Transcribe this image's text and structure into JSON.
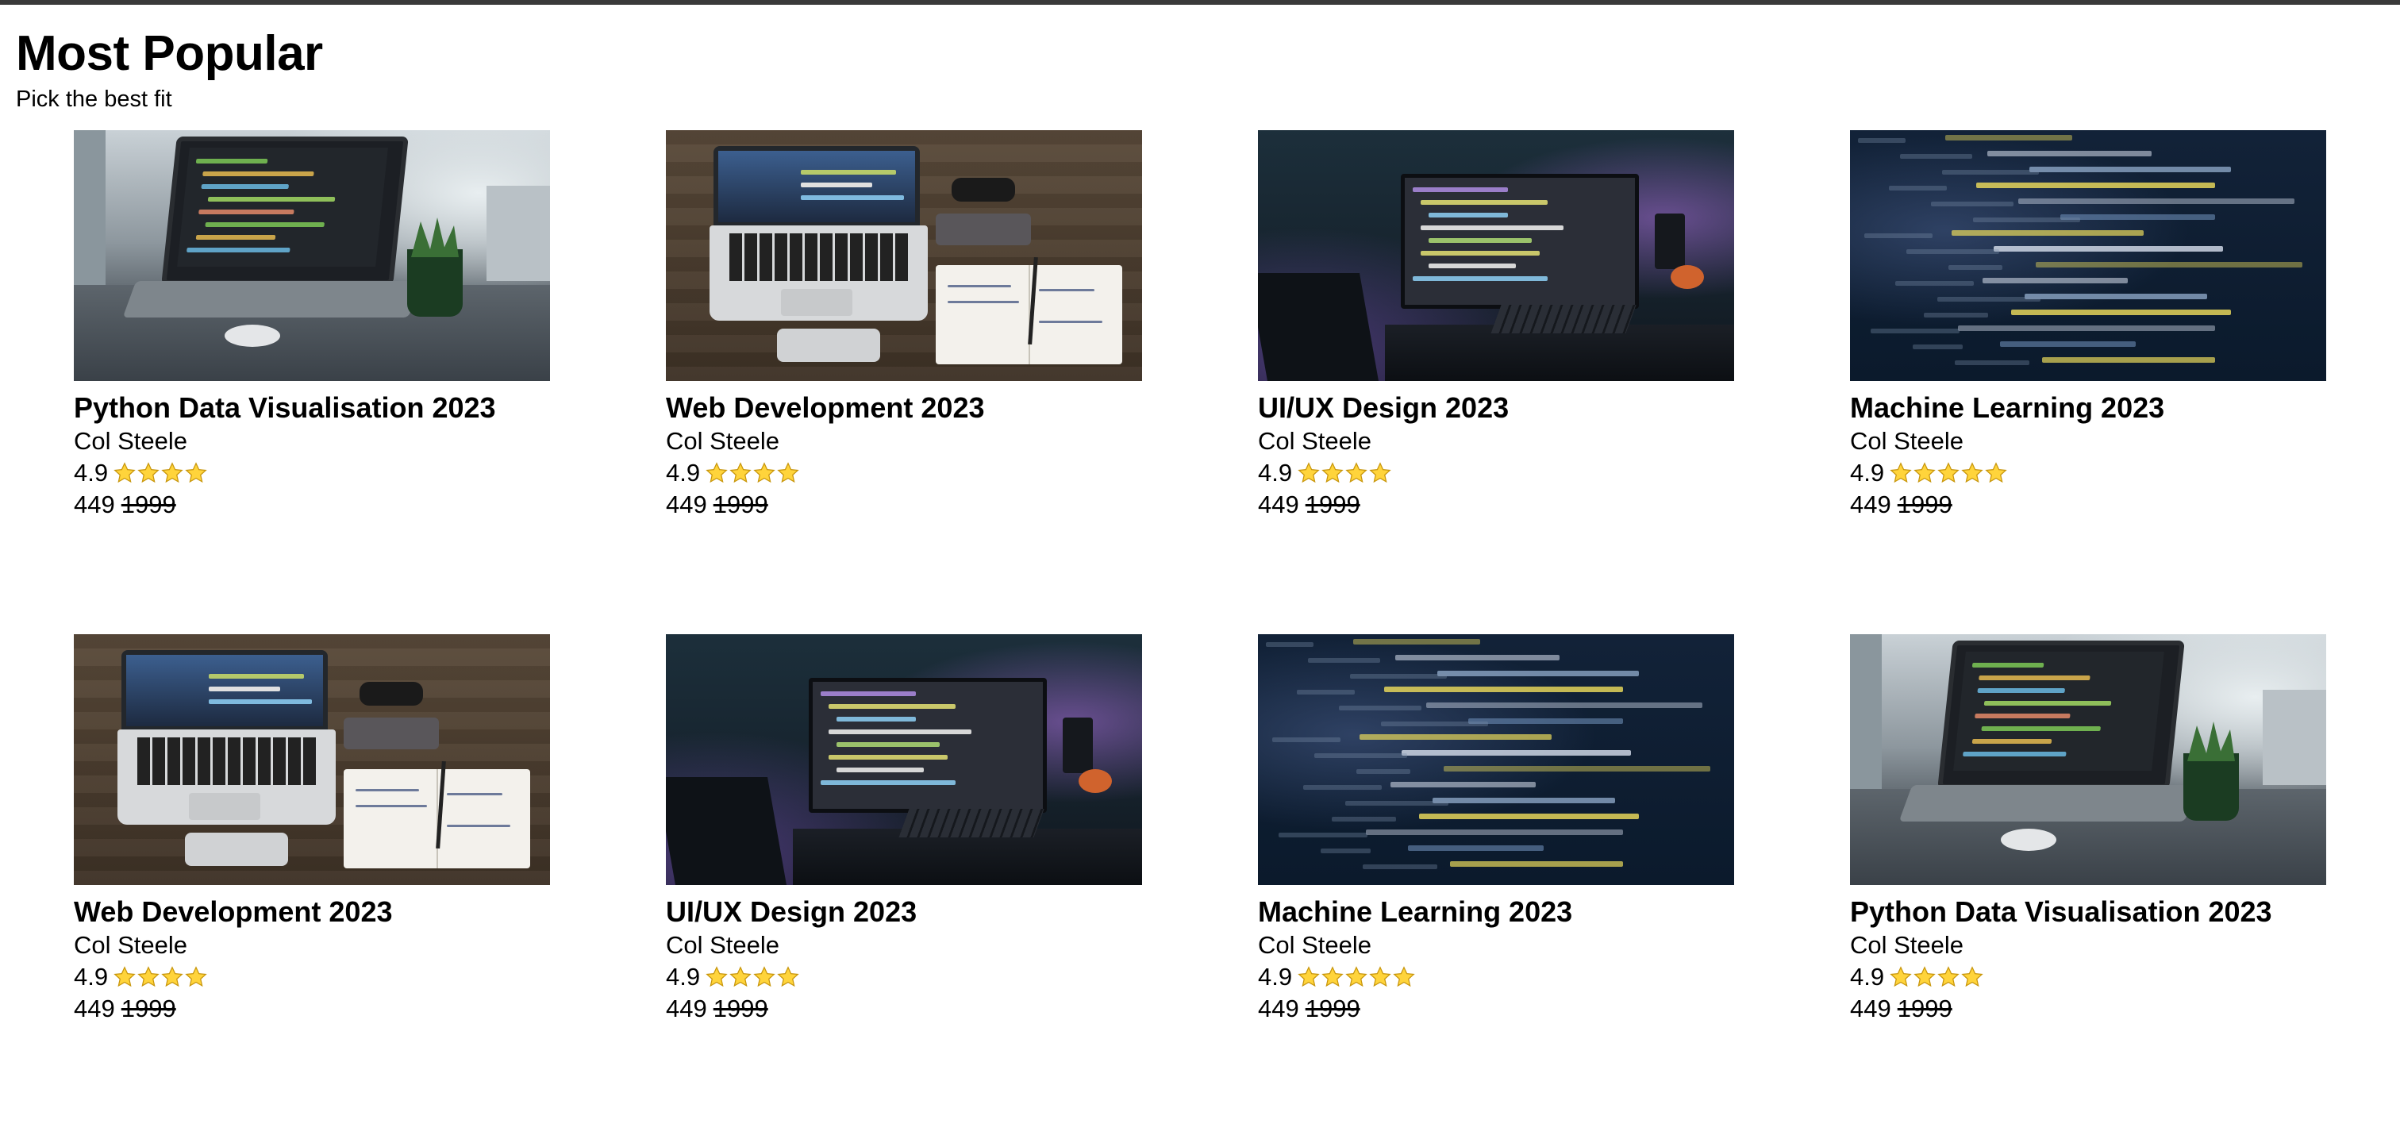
{
  "header": {
    "title": "Most Popular",
    "subtitle": "Pick the best fit"
  },
  "colors": {
    "star_fill": "#ffd43b",
    "star_stroke": "#c8960c",
    "top_bar": "#3a3a3a"
  },
  "courses": [
    {
      "title": "Python Data Visualisation 2023",
      "instructor": "Col Steele",
      "rating": "4.9",
      "stars": 4,
      "price": "449",
      "old_price": "1999",
      "image": "laptop-plant-photo"
    },
    {
      "title": "Web Development 2023",
      "instructor": "Col Steele",
      "rating": "4.9",
      "stars": 4,
      "price": "449",
      "old_price": "1999",
      "image": "laptop-desk-notebook-photo"
    },
    {
      "title": "UI/UX Design 2023",
      "instructor": "Col Steele",
      "rating": "4.9",
      "stars": 4,
      "price": "449",
      "old_price": "1999",
      "image": "monitor-purple-light-photo"
    },
    {
      "title": "Machine Learning 2023",
      "instructor": "Col Steele",
      "rating": "4.9",
      "stars": 5,
      "price": "449",
      "old_price": "1999",
      "image": "code-closeup-photo"
    },
    {
      "title": "Web Development 2023",
      "instructor": "Col Steele",
      "rating": "4.9",
      "stars": 4,
      "price": "449",
      "old_price": "1999",
      "image": "laptop-desk-notebook-photo"
    },
    {
      "title": "UI/UX Design 2023",
      "instructor": "Col Steele",
      "rating": "4.9",
      "stars": 4,
      "price": "449",
      "old_price": "1999",
      "image": "monitor-purple-light-photo"
    },
    {
      "title": "Machine Learning 2023",
      "instructor": "Col Steele",
      "rating": "4.9",
      "stars": 5,
      "price": "449",
      "old_price": "1999",
      "image": "code-closeup-photo"
    },
    {
      "title": "Python Data Visualisation 2023",
      "instructor": "Col Steele",
      "rating": "4.9",
      "stars": 4,
      "price": "449",
      "old_price": "1999",
      "image": "laptop-plant-photo"
    }
  ]
}
